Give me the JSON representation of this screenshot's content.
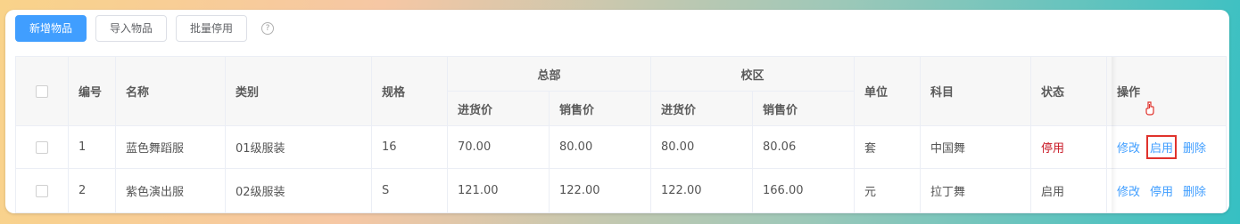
{
  "toolbar": {
    "add_label": "新增物品",
    "import_label": "导入物品",
    "batch_disable_label": "批量停用",
    "help_icon": "?"
  },
  "table": {
    "headers": {
      "id": "编号",
      "name": "名称",
      "category": "类别",
      "spec": "规格",
      "hq_group": "总部",
      "campus_group": "校区",
      "purchase_price": "进货价",
      "sale_price": "销售价",
      "unit": "单位",
      "subject": "科目",
      "status": "状态",
      "actions": "操作"
    },
    "rows": [
      {
        "id": "1",
        "name": "蓝色舞蹈服",
        "category": "01级服装",
        "spec": "16",
        "hq_purchase": "70.00",
        "hq_sale": "80.00",
        "campus_purchase": "80.00",
        "campus_sale": "80.06",
        "unit": "套",
        "subject": "中国舞",
        "status": "停用",
        "actions": [
          "修改",
          "启用",
          "删除"
        ]
      },
      {
        "id": "2",
        "name": "紫色演出服",
        "category": "02级服装",
        "spec": "S",
        "hq_purchase": "121.00",
        "hq_sale": "122.00",
        "campus_purchase": "122.00",
        "campus_sale": "166.00",
        "unit": "元",
        "subject": "拉丁舞",
        "status": "启用",
        "actions": [
          "修改",
          "停用",
          "删除"
        ]
      }
    ]
  },
  "colors": {
    "primary": "#409eff",
    "status_disabled": "#c81623",
    "highlight_box": "#e0322c"
  }
}
